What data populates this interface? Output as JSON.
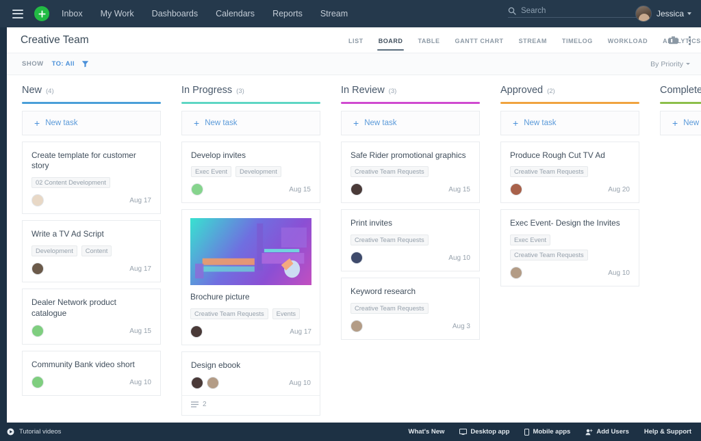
{
  "topnav": {
    "menu_icon": "hamburger-icon",
    "add_icon": "plus-icon",
    "links": [
      "Inbox",
      "My Work",
      "Dashboards",
      "Calendars",
      "Reports",
      "Stream"
    ],
    "search": {
      "placeholder": "Search",
      "value": "",
      "icon": "search-icon"
    },
    "user": {
      "name": "Jessica",
      "avatar": "user-avatar",
      "caret": "chevron-down-icon"
    }
  },
  "titlebar": {
    "project": "Creative Team",
    "tabs": [
      {
        "label": "LIST",
        "active": false
      },
      {
        "label": "BOARD",
        "active": true
      },
      {
        "label": "TABLE",
        "active": false
      },
      {
        "label": "GANTT CHART",
        "active": false
      },
      {
        "label": "STREAM",
        "active": false
      },
      {
        "label": "TIMELOG",
        "active": false
      },
      {
        "label": "WORKLOAD",
        "active": false
      },
      {
        "label": "ANALYTICS",
        "active": false
      }
    ],
    "folder_icon": "briefcase-icon",
    "more_icon": "kebab-menu-icon"
  },
  "filterbar": {
    "show_label": "SHOW",
    "to_all": "TO: All",
    "filter_icon": "funnel-icon",
    "sort": "By Priority",
    "sort_caret": "chevron-down-icon"
  },
  "board": {
    "new_task_label": "New task",
    "columns": [
      {
        "name": "New",
        "count": "(4)",
        "color": "#4a9fd8",
        "cards": [
          {
            "title": "Create template for customer story",
            "tags": [
              "02 Content Development"
            ],
            "avatars": [
              "#c9a98e"
            ],
            "date": "Aug 17"
          },
          {
            "title": "Write a TV Ad Script",
            "tags": [
              "Development",
              "Content"
            ],
            "avatars": [
              "#6b5a4a"
            ],
            "date": "Aug 17"
          },
          {
            "title": "Dealer Network product catalogue",
            "tags": [],
            "avatars": [
              "#7fce7f"
            ],
            "date": "Aug 15"
          },
          {
            "title": "Community Bank video short",
            "tags": [],
            "avatars": [
              "#7fce7f"
            ],
            "date": "Aug 10"
          }
        ]
      },
      {
        "name": "In Progress",
        "count": "(3)",
        "color": "#5ed6c4",
        "cards": [
          {
            "title": "Develop invites",
            "tags": [
              "Exec Event",
              "Development"
            ],
            "avatars": [
              "#86d48d"
            ],
            "date": "Aug 15"
          },
          {
            "title": "Brochure picture",
            "tags": [
              "Creative Team Requests",
              "Events"
            ],
            "avatars": [
              "#4a3a38"
            ],
            "date": "Aug 17",
            "image": "brochure-thumbnail"
          },
          {
            "title": "Design ebook",
            "tags": [],
            "avatars": [
              "#4a3a38",
              "#b39c86"
            ],
            "date": "Aug 10",
            "subtasks": "2",
            "subtask_icon": "list-icon"
          }
        ]
      },
      {
        "name": "In Review",
        "count": "(3)",
        "color": "#d04ad0",
        "cards": [
          {
            "title": "Safe Rider promotional graphics",
            "tags": [
              "Creative Team Requests"
            ],
            "avatars": [
              "#4a3a38"
            ],
            "date": "Aug 15"
          },
          {
            "title": "Print invites",
            "tags": [
              "Creative Team Requests"
            ],
            "avatars": [
              "#3e4a6b"
            ],
            "date": "Aug 10"
          },
          {
            "title": "Keyword research",
            "tags": [
              "Creative Team Requests"
            ],
            "avatars": [
              "#b39c86"
            ],
            "date": "Aug 3"
          }
        ]
      },
      {
        "name": "Approved",
        "count": "(2)",
        "color": "#f0a33f",
        "cards": [
          {
            "title": "Produce Rough Cut TV Ad",
            "tags": [
              "Creative Team Requests"
            ],
            "avatars": [
              "#a8614a"
            ],
            "date": "Aug 20"
          },
          {
            "title": "Exec Event- Design the Invites",
            "tags": [
              "Exec Event",
              "Creative Team Requests"
            ],
            "avatars": [
              "#b39c86"
            ],
            "date": "Aug 10"
          }
        ]
      },
      {
        "name": "Completed",
        "count": "",
        "color": "#8cbf4a",
        "cards": []
      }
    ]
  },
  "footer": {
    "tutorial": {
      "label": "Tutorial videos",
      "icon": "play-circle-icon"
    },
    "items": [
      {
        "label": "What's New",
        "icon": ""
      },
      {
        "label": "Desktop app",
        "icon": "monitor-icon"
      },
      {
        "label": "Mobile apps",
        "icon": "phone-icon"
      },
      {
        "label": "Add Users",
        "icon": "add-user-icon"
      },
      {
        "label": "Help & Support",
        "icon": ""
      }
    ]
  }
}
